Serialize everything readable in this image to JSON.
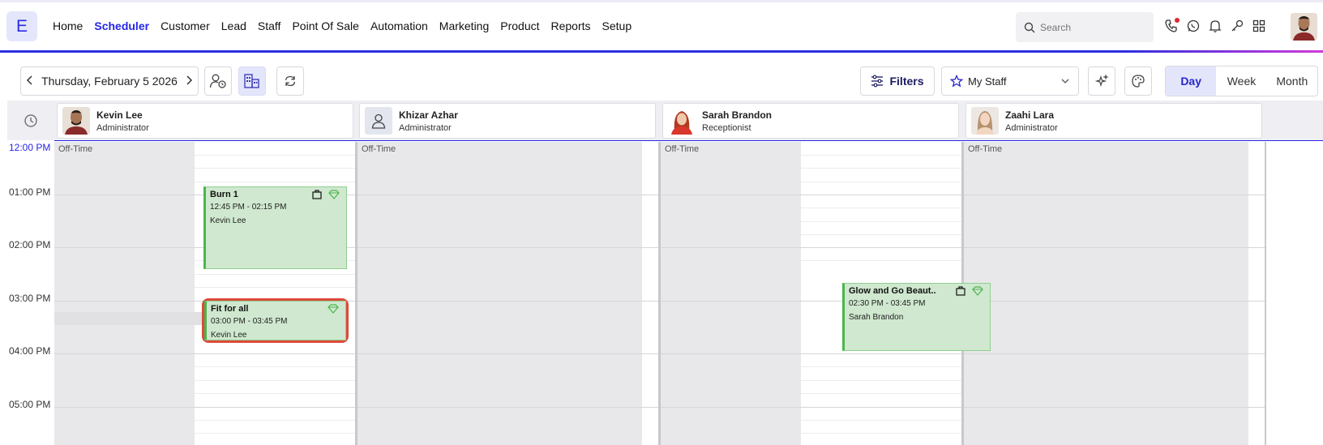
{
  "app": {
    "logo_letter": "E"
  },
  "nav": {
    "items": [
      "Home",
      "Scheduler",
      "Customer",
      "Lead",
      "Staff",
      "Point Of Sale",
      "Automation",
      "Marketing",
      "Product",
      "Reports",
      "Setup"
    ],
    "active_index": 1
  },
  "search": {
    "placeholder": "Search"
  },
  "top_icons": [
    "phone-icon",
    "whatsapp-icon",
    "bell-icon",
    "key-icon",
    "apps-grid-icon"
  ],
  "toolbar": {
    "date": "Thursday, February 5 2026",
    "filters_label": "Filters",
    "staff_select": "My Staff",
    "views": [
      "Day",
      "Week",
      "Month"
    ],
    "active_view": "Day"
  },
  "staff": [
    {
      "name": "Kevin Lee",
      "role": "Administrator"
    },
    {
      "name": "Khizar Azhar",
      "role": "Administrator"
    },
    {
      "name": "Sarah Brandon",
      "role": "Receptionist"
    },
    {
      "name": "Zaahi Lara",
      "role": "Administrator"
    }
  ],
  "times": [
    "12:00 PM",
    "01:00 PM",
    "02:00 PM",
    "03:00 PM",
    "04:00 PM",
    "05:00 PM"
  ],
  "off_time_label": "Off-Time",
  "appointments": [
    {
      "title": "Burn 1",
      "time": "12:45 PM - 02:15 PM",
      "staff": "Kevin Lee"
    },
    {
      "title": "Fit for all",
      "time": "03:00 PM - 03:45 PM",
      "staff": "Kevin Lee"
    },
    {
      "title": "Glow and Go Beaut..",
      "time": "02:30 PM - 03:45 PM",
      "staff": "Sarah Brandon"
    }
  ],
  "colors": {
    "accent": "#2626e8",
    "appointment_bg": "#cfe8cf",
    "appointment_border": "#4cb54c",
    "highlight": "#dd4a3a"
  }
}
